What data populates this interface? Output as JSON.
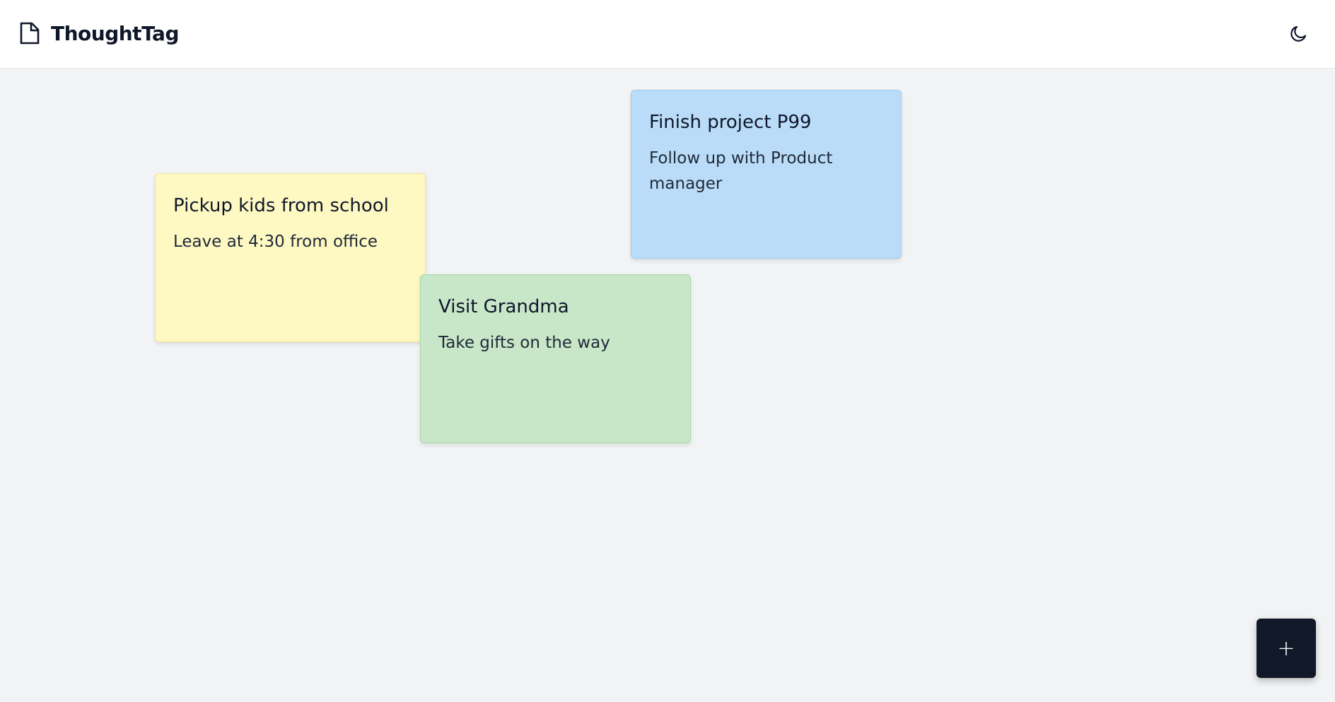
{
  "header": {
    "app_name": "ThoughtTag",
    "logo_icon": "file-icon",
    "theme_toggle_icon": "moon-icon"
  },
  "notes": [
    {
      "title": "Pickup kids from school",
      "body": "Leave at 4:30 from office",
      "color": "#fef8c2"
    },
    {
      "title": "Finish project P99",
      "body": "Follow up with Product manager",
      "color": "#badcf8"
    },
    {
      "title": "Visit Grandma",
      "body": "Take gifts on the way",
      "color": "#c8e6c8"
    }
  ],
  "fab": {
    "label": "+",
    "icon": "plus-icon",
    "color": "#111827"
  }
}
